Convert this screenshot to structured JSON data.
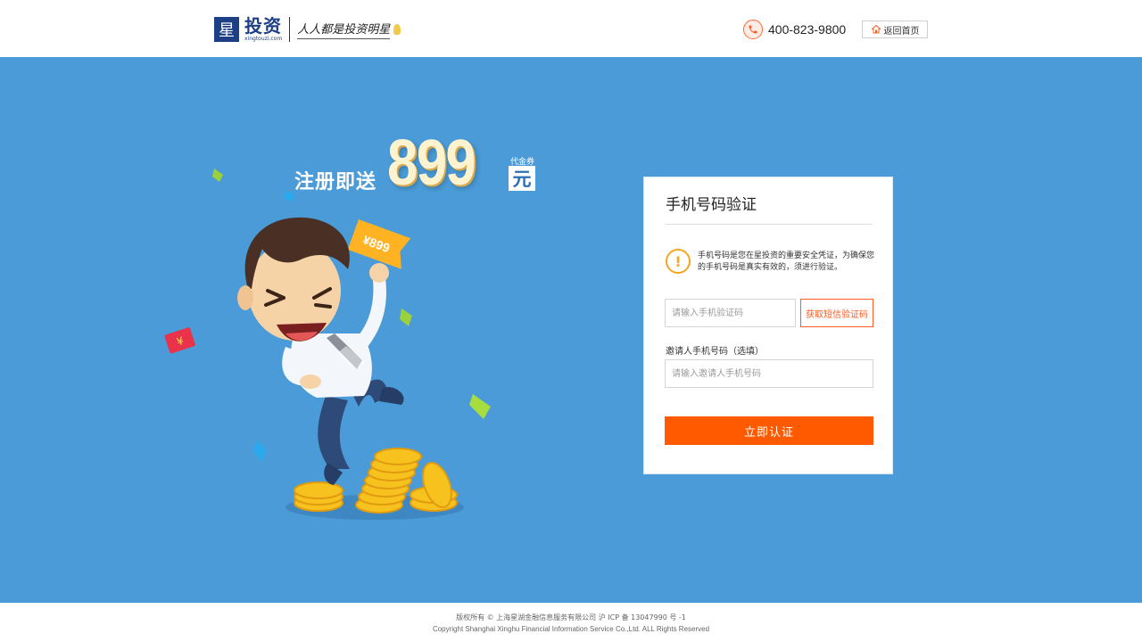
{
  "header": {
    "logo_mark": "星",
    "logo_name": "投资",
    "logo_domain": "xingtouzi.com",
    "slogan": "人人都是投资明星",
    "phone": "400-823-9800",
    "home_button": "返回首页"
  },
  "promo": {
    "lead": "注册即送",
    "amount": "899",
    "voucher_label": "代金券",
    "unit": "元",
    "ticket_text": "¥899"
  },
  "form": {
    "title": "手机号码验证",
    "notice": "手机号码是您在星投资的重要安全凭证，为确保您的手机号码是真实有效的，须进行验证。",
    "code_placeholder": "请输入手机验证码",
    "code_button": "获取短信验证码",
    "invite_label": "邀请人手机号码（选填）",
    "invite_placeholder": "请输入邀请人手机号码",
    "submit": "立即认证"
  },
  "footer": {
    "line1": "版权所有 © 上海星湖金融信息服务有限公司 沪 ICP 备 13047990 号 -1",
    "line2": "Copyright Shanghai Xinghu Financial Information Service Co.,Ltd. ALL Rights Reserved"
  },
  "colors": {
    "banner": "#4a9bd7",
    "accent": "#ff5a00",
    "brand": "#1d3f86",
    "warning": "#f5a623"
  }
}
